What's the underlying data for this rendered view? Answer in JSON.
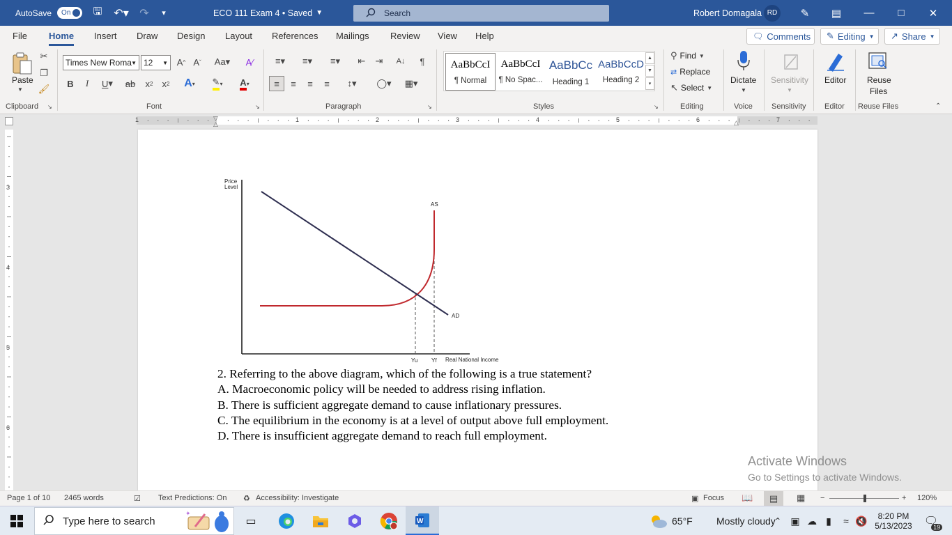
{
  "titlebar": {
    "autosave_label": "AutoSave",
    "autosave_state": "On",
    "doc_title": "ECO 111 Exam 4 • Saved",
    "search_label": "Search",
    "user_name": "Robert Domagala",
    "user_initials": "RD"
  },
  "tabs": [
    "File",
    "Home",
    "Insert",
    "Draw",
    "Design",
    "Layout",
    "References",
    "Mailings",
    "Review",
    "View",
    "Help"
  ],
  "right_buttons": {
    "comments": "Comments",
    "editing": "Editing",
    "share": "Share"
  },
  "ribbon": {
    "clipboard": {
      "label": "Clipboard",
      "paste": "Paste"
    },
    "font": {
      "label": "Font",
      "font_name": "Times New Roma",
      "font_size": "12"
    },
    "paragraph": {
      "label": "Paragraph"
    },
    "styles": {
      "label": "Styles",
      "items": [
        {
          "sample": "AaBbCcI",
          "name": "¶ Normal"
        },
        {
          "sample": "AaBbCcI",
          "name": "¶ No Spac..."
        },
        {
          "sample": "AaBbCc",
          "name": "Heading 1"
        },
        {
          "sample": "AaBbCcD",
          "name": "Heading 2"
        }
      ]
    },
    "editing": {
      "label": "Editing",
      "find": "Find",
      "replace": "Replace",
      "select": "Select"
    },
    "voice": {
      "label": "Voice",
      "dictate": "Dictate"
    },
    "sensitivity": {
      "label": "Sensitivity",
      "button": "Sensitivity"
    },
    "editor": {
      "label": "Editor",
      "button": "Editor"
    },
    "reuse": {
      "label": "Reuse Files",
      "button_line1": "Reuse",
      "button_line2": "Files"
    }
  },
  "ruler": {
    "h_numbers": [
      "1",
      "1",
      "2",
      "3",
      "4",
      "5",
      "6",
      "7"
    ],
    "v_numbers": [
      "3",
      "4",
      "5",
      "6"
    ]
  },
  "chart_data": {
    "type": "line",
    "ylabel_line1": "Price",
    "ylabel_line2": "Level",
    "xlabel": "Real National Income",
    "x_ticks": [
      "Yu",
      "Yf"
    ],
    "series": [
      {
        "name": "AD",
        "color": "#2e2e50"
      },
      {
        "name": "AS",
        "color": "#c0282d"
      }
    ]
  },
  "question": {
    "stem": "2. Referring to the above diagram, which of the following is a true statement?",
    "options": [
      "A. Macroeconomic policy will be needed to address rising inflation.",
      "B. There is sufficient aggregate demand to cause inflationary pressures.",
      "C. The equilibrium in the economy is at a level of output above full employment.",
      "D. There is insufficient aggregate demand to reach full employment."
    ]
  },
  "watermark": {
    "line1": "Activate Windows",
    "line2": "Go to Settings to activate Windows."
  },
  "statusbar": {
    "page": "Page 1 of 10",
    "words": "2465 words",
    "predictions": "Text Predictions: On",
    "accessibility": "Accessibility: Investigate",
    "focus": "Focus",
    "zoom_minus": "−",
    "zoom_plus": "+",
    "zoom": "120%"
  },
  "taskbar": {
    "search_placeholder": "Type here to search",
    "weather_temp": "65°F",
    "weather_desc": "Mostly cloudy",
    "time": "8:20 PM",
    "date": "5/13/2023",
    "notifications": "19"
  },
  "colors": {
    "brand": "#2b579a",
    "ad_line": "#2e2e50",
    "as_curve": "#c0282d"
  }
}
